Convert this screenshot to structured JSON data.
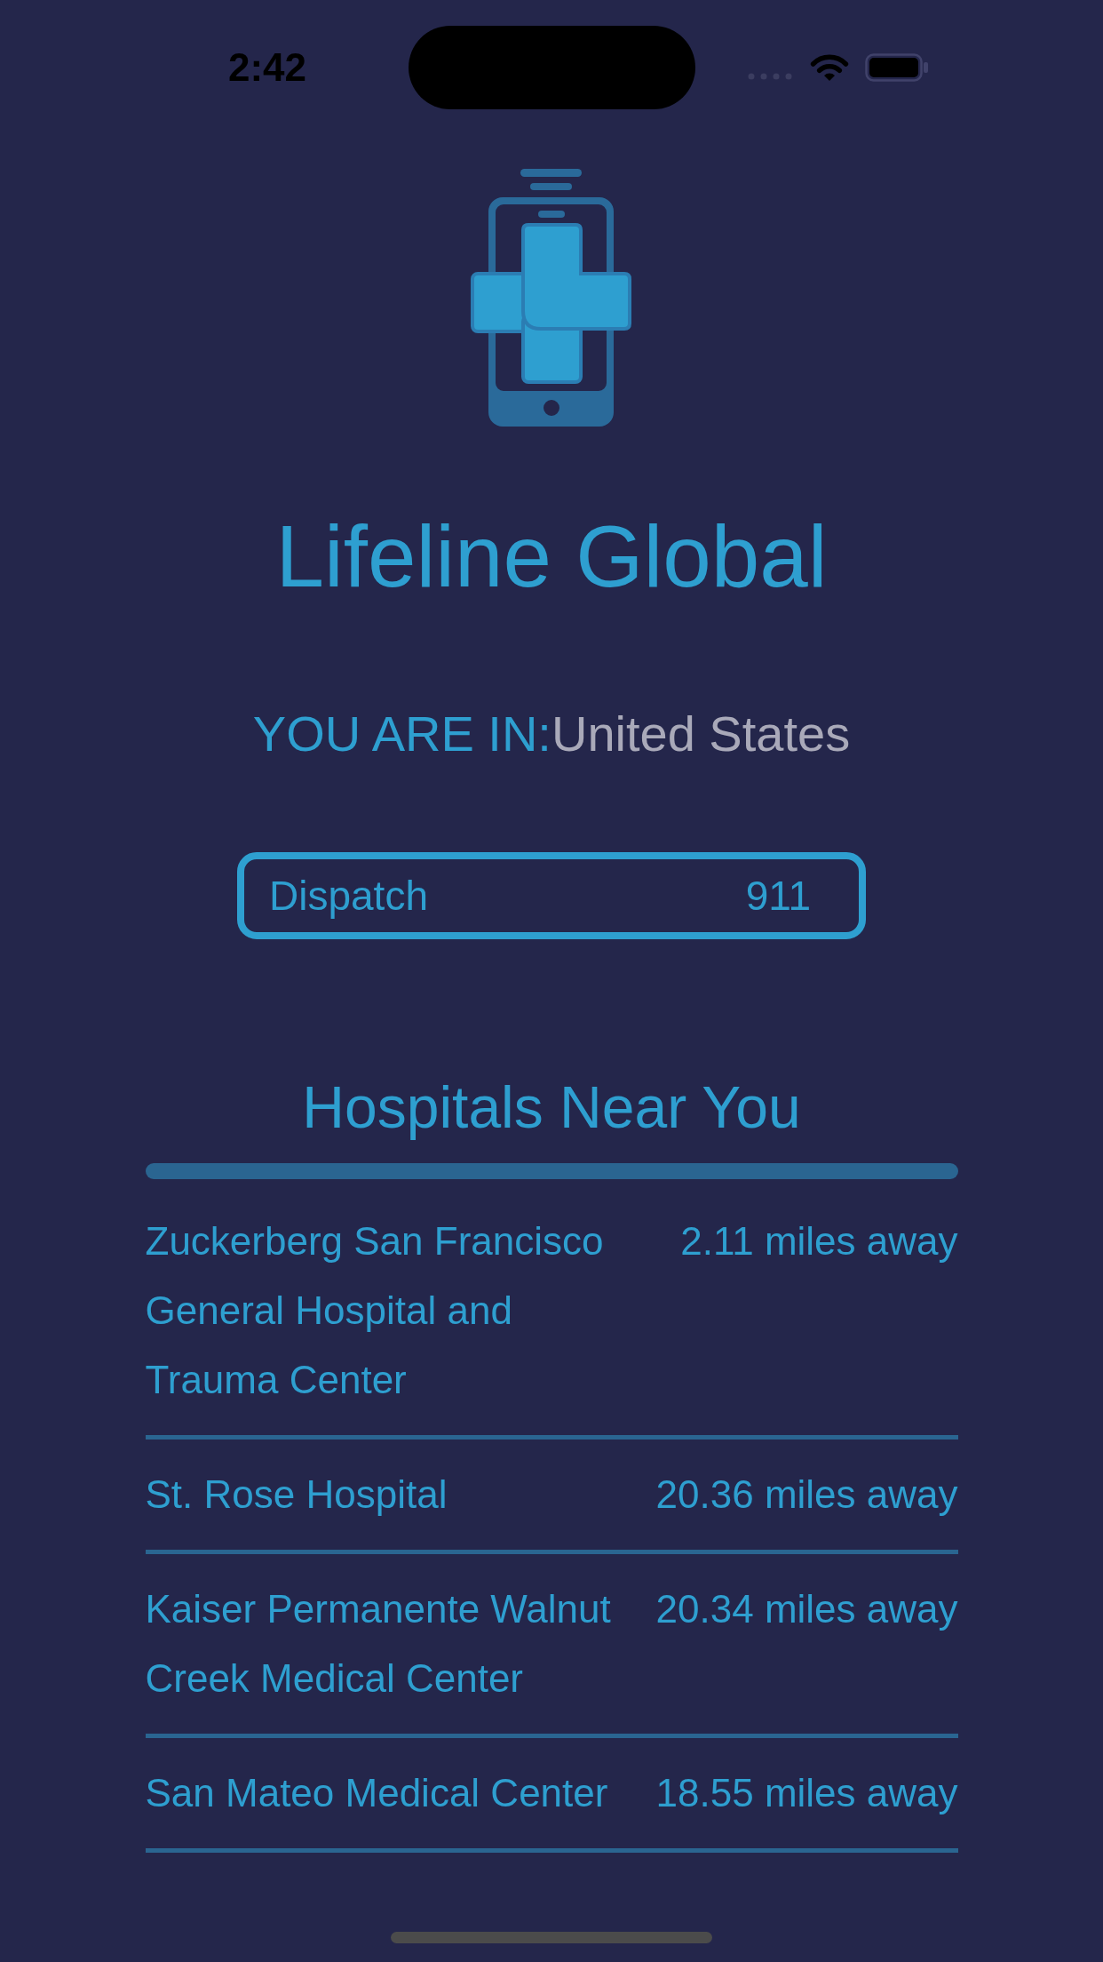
{
  "status_bar": {
    "time": "2:42"
  },
  "app": {
    "title": "Lifeline Global"
  },
  "location": {
    "label": "YOU ARE IN:",
    "country": "United States"
  },
  "emergency_contacts": [
    {
      "service": "Dispatch",
      "number": "911"
    }
  ],
  "hospitals": {
    "title": "Hospitals Near You",
    "items": [
      {
        "name": "Zuckerberg San Francisco General Hospital and Trauma Center",
        "distance": "2.11 miles away"
      },
      {
        "name": "St. Rose Hospital",
        "distance": "20.36 miles away"
      },
      {
        "name": "Kaiser Permanente Walnut Creek Medical Center",
        "distance": "20.34 miles away"
      },
      {
        "name": "San Mateo Medical Center",
        "distance": "18.55 miles away"
      }
    ]
  }
}
